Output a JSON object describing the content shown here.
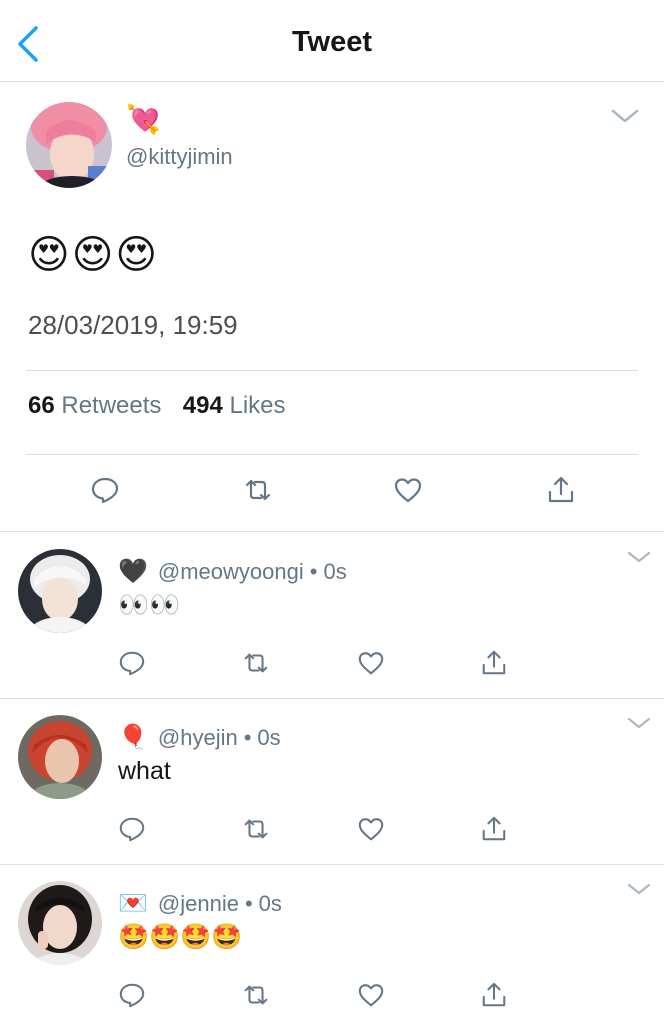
{
  "nav": {
    "title": "Tweet"
  },
  "tweet": {
    "name_emoji": "💘",
    "handle": "@kittyjimin",
    "text": "😍😍😍",
    "timestamp": "28/03/2019, 19:59",
    "retweets_count": "66",
    "retweets_label": "Retweets",
    "likes_count": "494",
    "likes_label": "Likes"
  },
  "replies": [
    {
      "name_emoji": "🖤",
      "handle": "@meowyoongi",
      "separator": "•",
      "time": "0s",
      "text": "👀👀"
    },
    {
      "name_emoji": "🎈",
      "handle": "@hyejin",
      "separator": "•",
      "time": "0s",
      "text": "what"
    },
    {
      "name_emoji": "💌",
      "handle": "@jennie",
      "separator": "•",
      "time": "0s",
      "text": "🤩🤩🤩🤩"
    }
  ],
  "icons": {
    "back": "chevron-left-icon",
    "more": "chevron-down-icon",
    "reply": "reply-bubble-icon",
    "retweet": "retweet-icon",
    "like": "heart-icon",
    "share": "share-icon"
  },
  "colors": {
    "accent": "#1da1f2",
    "icon": "#657786",
    "text": "#14171a",
    "secondary": "#657786",
    "divider": "#dcdfe2"
  }
}
